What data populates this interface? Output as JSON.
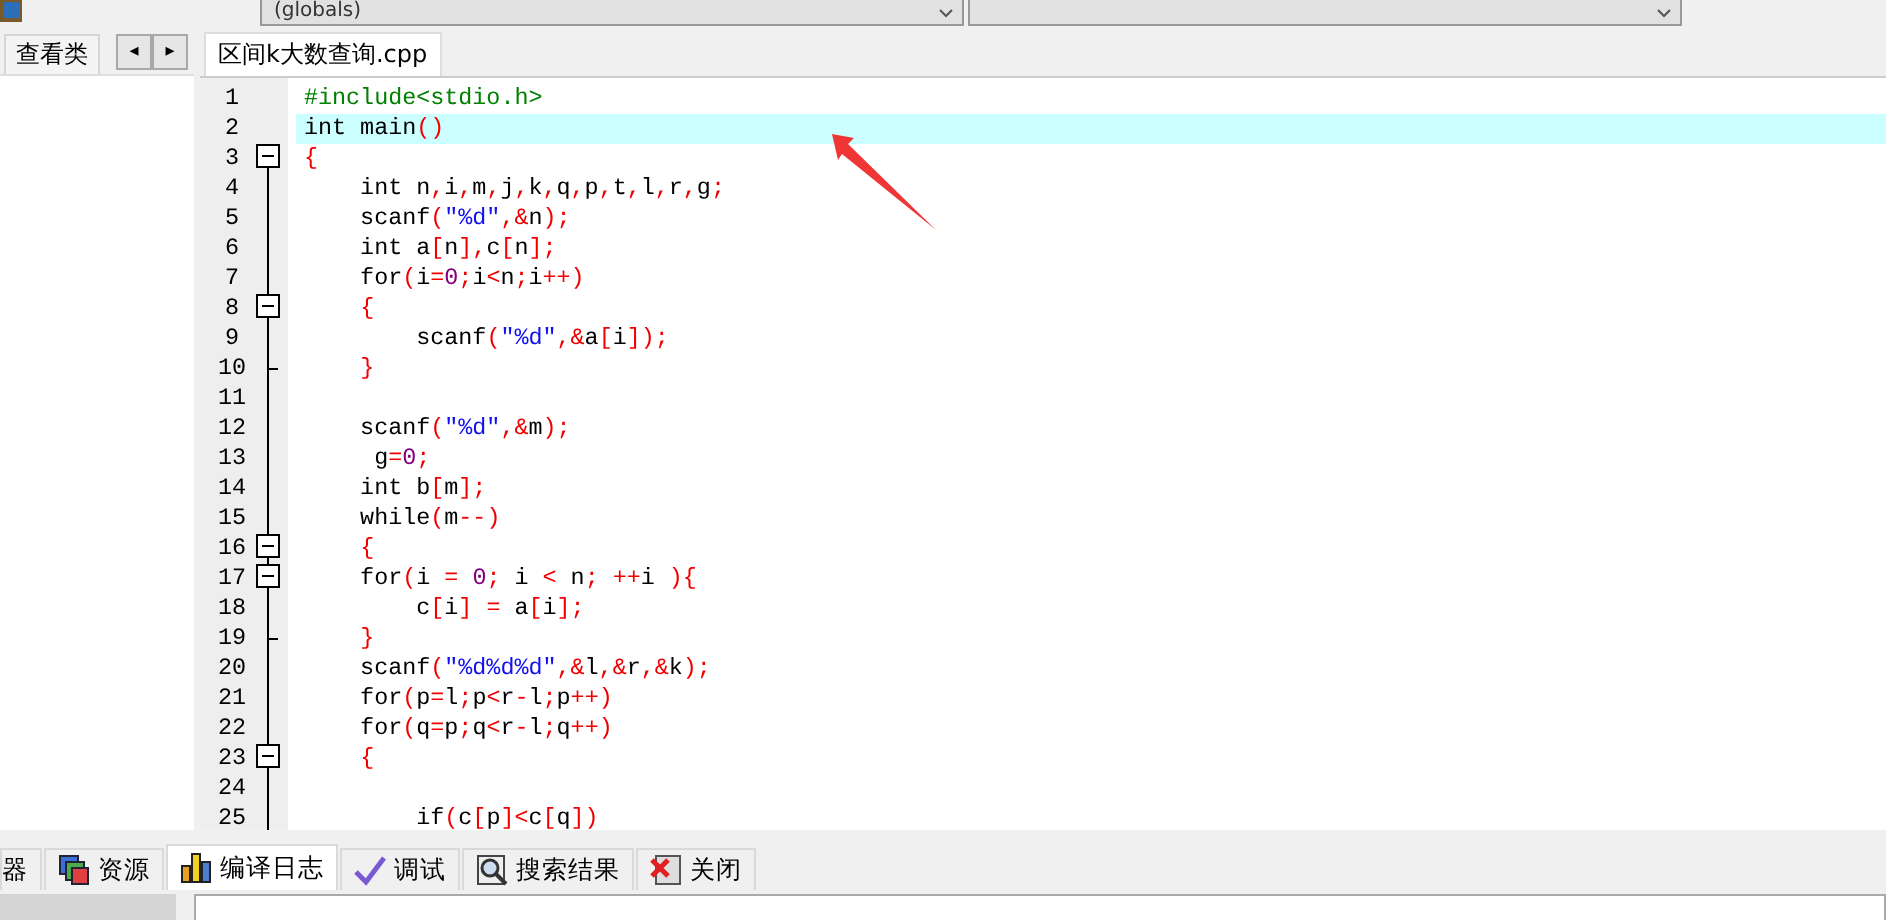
{
  "toolbar": {
    "scope_dropdown": "(globals)"
  },
  "left_panel": {
    "tabs": [
      {
        "label": "查看类",
        "selected": true
      }
    ],
    "scroll_buttons": [
      "◂",
      "▸"
    ]
  },
  "editor_tabs": [
    {
      "label": "区间k大数查询.cpp",
      "selected": true
    }
  ],
  "code_lines": [
    {
      "number": "1",
      "kind": "plain",
      "highlighted": false,
      "text": "#include<stdio.h>"
    },
    {
      "number": "2",
      "kind": "plain",
      "highlighted": true,
      "text": "int main()"
    },
    {
      "number": "3",
      "kind": "toggle",
      "highlighted": false,
      "text": "{"
    },
    {
      "number": "4",
      "kind": "guide",
      "highlighted": false,
      "text": "    int n,i,m,j,k,q,p,t,l,r,g;"
    },
    {
      "number": "5",
      "kind": "guide",
      "highlighted": false,
      "text": "    scanf(\"%d\",&n);"
    },
    {
      "number": "6",
      "kind": "guide",
      "highlighted": false,
      "text": "    int a[n],c[n];"
    },
    {
      "number": "7",
      "kind": "guide",
      "highlighted": false,
      "text": "    for(i=0;i<n;i++)"
    },
    {
      "number": "8",
      "kind": "toggle",
      "highlighted": false,
      "text": "    {"
    },
    {
      "number": "9",
      "kind": "guide",
      "highlighted": false,
      "text": "        scanf(\"%d\",&a[i]);"
    },
    {
      "number": "10",
      "kind": "end",
      "highlighted": false,
      "text": "    }"
    },
    {
      "number": "11",
      "kind": "guide"
    },
    {
      "number": "12",
      "kind": "guide",
      "highlighted": false,
      "text": "    scanf(\"%d\",&m);"
    },
    {
      "number": "13",
      "kind": "guide",
      "highlighted": false,
      "text": "     g=0;"
    },
    {
      "number": "14",
      "kind": "guide",
      "highlighted": false,
      "text": "    int b[m];"
    },
    {
      "number": "15",
      "kind": "guide",
      "highlighted": false,
      "text": "    while(m--)"
    },
    {
      "number": "16",
      "kind": "toggle",
      "highlighted": false,
      "text": "    {"
    },
    {
      "number": "17",
      "kind": "toggle",
      "highlighted": false,
      "text": "    for(i = 0; i < n; ++i ){"
    },
    {
      "number": "18",
      "kind": "guide",
      "highlighted": false,
      "text": "        c[i] = a[i];"
    },
    {
      "number": "19",
      "kind": "end",
      "highlighted": false,
      "text": "    }"
    },
    {
      "number": "20",
      "kind": "guide",
      "highlighted": false,
      "text": "    scanf(\"%d%d%d\",&l,&r,&k);"
    },
    {
      "number": "21",
      "kind": "guide",
      "highlighted": false,
      "text": "    for(p=l;p<r-l;p++)"
    },
    {
      "number": "22",
      "kind": "guide",
      "highlighted": false,
      "text": "    for(q=p;q<r-l;q++)"
    },
    {
      "number": "23",
      "kind": "toggle",
      "highlighted": false,
      "text": "    {"
    },
    {
      "number": "24",
      "kind": "guide"
    },
    {
      "number": "25",
      "kind": "guide",
      "highlighted": false,
      "text": "        if(c[p]<c[q])"
    }
  ],
  "bottom_tabs": [
    {
      "label": "器",
      "kind": "plain",
      "selected": false
    },
    {
      "label": "资源",
      "kind": "resources",
      "selected": false
    },
    {
      "label": "编译日志",
      "kind": "chart",
      "selected": true
    },
    {
      "label": "调试",
      "kind": "check",
      "selected": false
    },
    {
      "label": "搜索结果",
      "kind": "search",
      "selected": false
    },
    {
      "label": "关闭",
      "kind": "close",
      "selected": false
    }
  ]
}
